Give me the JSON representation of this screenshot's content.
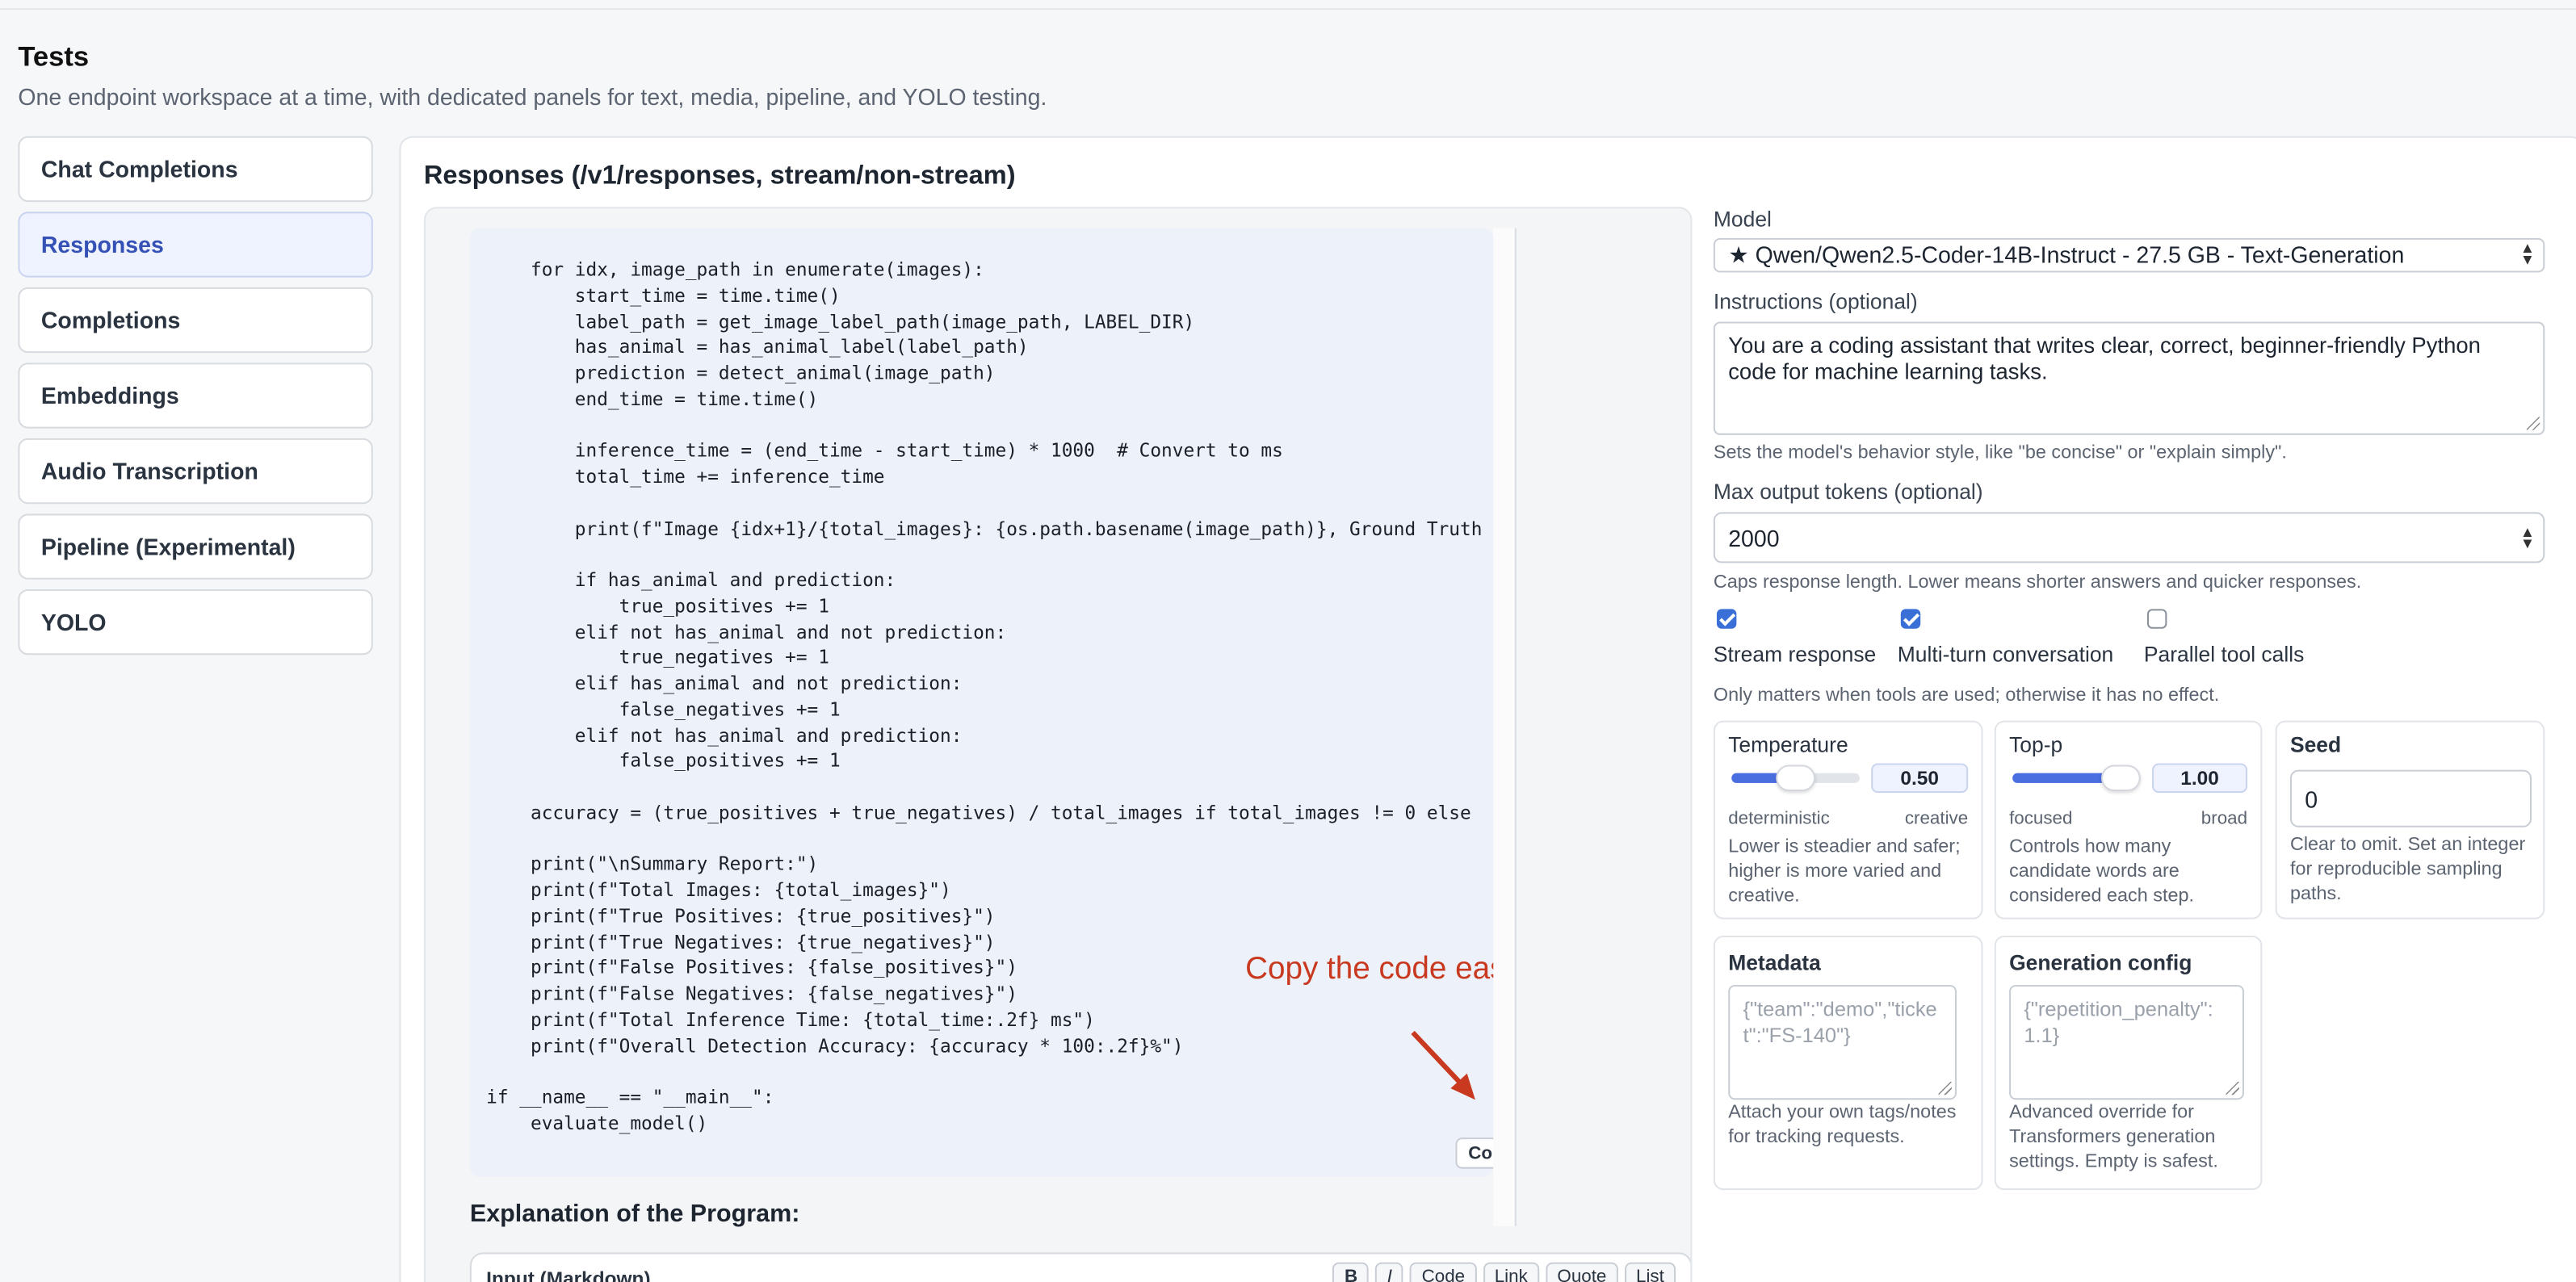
{
  "header": {
    "title": "Tests",
    "subtitle": "One endpoint workspace at a time, with dedicated panels for text, media, pipeline, and YOLO testing."
  },
  "nav": {
    "items": [
      {
        "label": "Chat Completions"
      },
      {
        "label": "Responses",
        "active": true
      },
      {
        "label": "Completions"
      },
      {
        "label": "Embeddings"
      },
      {
        "label": "Audio Transcription"
      },
      {
        "label": "Pipeline (Experimental)"
      },
      {
        "label": "YOLO"
      }
    ]
  },
  "panel": {
    "title": "Responses (/v1/responses, stream/non-stream)"
  },
  "chat": {
    "code_lines": [
      "    for idx, image_path in enumerate(images):",
      "        start_time = time.time()",
      "        label_path = get_image_label_path(image_path, LABEL_DIR)",
      "        has_animal = has_animal_label(label_path)",
      "        prediction = detect_animal(image_path)",
      "        end_time = time.time()",
      "",
      "        inference_time = (end_time - start_time) * 1000  # Convert to ms",
      "        total_time += inference_time",
      "",
      "        print(f\"Image {idx+1}/{total_images}: {os.path.basename(image_path)}, Ground Truth",
      "",
      "        if has_animal and prediction:",
      "            true_positives += 1",
      "        elif not has_animal and not prediction:",
      "            true_negatives += 1",
      "        elif has_animal and not prediction:",
      "            false_negatives += 1",
      "        elif not has_animal and prediction:",
      "            false_positives += 1",
      "",
      "    accuracy = (true_positives + true_negatives) / total_images if total_images != 0 else",
      "",
      "    print(\"\\nSummary Report:\")",
      "    print(f\"Total Images: {total_images}\")",
      "    print(f\"True Positives: {true_positives}\")",
      "    print(f\"True Negatives: {true_negatives}\")",
      "    print(f\"False Positives: {false_positives}\")",
      "    print(f\"False Negatives: {false_negatives}\")",
      "    print(f\"Total Inference Time: {total_time:.2f} ms\")",
      "    print(f\"Overall Detection Accuracy: {accuracy * 100:.2f}%\")",
      "",
      "if __name__ == \"__main__\":",
      "    evaluate_model()"
    ],
    "annotation": "Copy the code easily",
    "copy_label": "Copy",
    "explanation_heading": "Explanation of the Program:",
    "input_label": "Input (Markdown)",
    "md_tools": [
      "B",
      "I",
      "Code",
      "Link",
      "Quote",
      "List"
    ]
  },
  "settings": {
    "model_label": "Model",
    "model_value": "★ Qwen/Qwen2.5-Coder-14B-Instruct - 27.5 GB - Text-Generation",
    "instructions_label": "Instructions (optional)",
    "instructions_value": "You are a coding assistant that writes clear, correct, beginner-friendly Python code for machine learning tasks.",
    "instructions_hint": "Sets the model's behavior style, like \"be concise\" or \"explain simply\".",
    "max_tokens_label": "Max output tokens (optional)",
    "max_tokens_value": "2000",
    "max_tokens_hint": "Caps response length. Lower means shorter answers and quicker responses.",
    "checkboxes": [
      {
        "label": "Stream response",
        "checked": true
      },
      {
        "label": "Multi-turn conversation",
        "checked": true
      },
      {
        "label": "Parallel tool calls",
        "checked": false
      }
    ],
    "tools_hint": "Only matters when tools are used; otherwise it has no effect.",
    "temperature": {
      "label": "Temperature",
      "value": "0.50",
      "level": 0.5,
      "min_label": "deterministic",
      "max_label": "creative",
      "desc": "Lower is steadier and safer; higher is more varied and creative."
    },
    "top_p": {
      "label": "Top-p",
      "value": "1.00",
      "level": 1.0,
      "min_label": "focused",
      "max_label": "broad",
      "desc": "Controls how many candidate words are considered each step."
    },
    "seed": {
      "label": "Seed",
      "value": "0",
      "desc": "Clear to omit. Set an integer for reproducible sampling paths."
    },
    "metadata": {
      "label": "Metadata",
      "placeholder": "{\"team\":\"demo\",\"ticket\":\"FS-140\"}",
      "desc": "Attach your own tags/notes for tracking requests."
    },
    "generation_config": {
      "label": "Generation config",
      "placeholder": "{\"repetition_penalty\": 1.1}",
      "desc": "Advanced override for Transformers generation settings. Empty is safest."
    }
  },
  "colors": {
    "accent": "#3a6fd8",
    "annotation": "#c8391f",
    "active_nav": "#3551b5"
  }
}
